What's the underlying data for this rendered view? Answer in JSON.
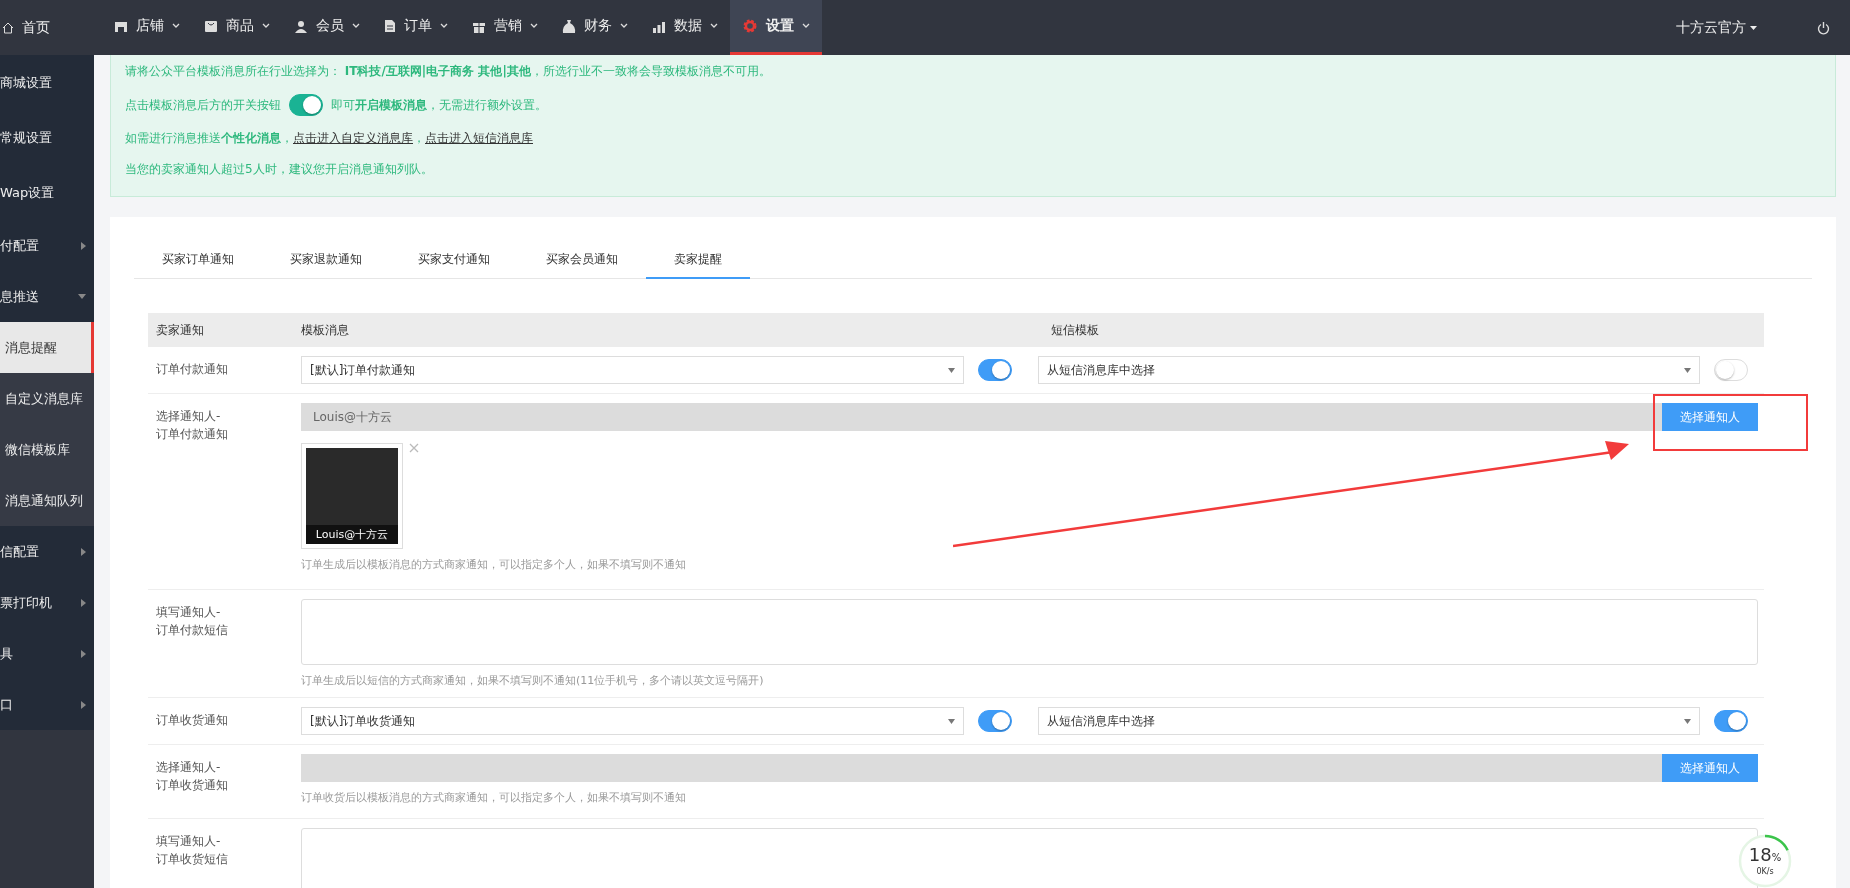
{
  "nav": {
    "home": "首页",
    "items": [
      {
        "label": "店铺",
        "selected": false
      },
      {
        "label": "商品",
        "selected": false
      },
      {
        "label": "会员",
        "selected": false
      },
      {
        "label": "订单",
        "selected": false
      },
      {
        "label": "营销",
        "selected": false
      },
      {
        "label": "财务",
        "selected": false
      },
      {
        "label": "数据",
        "selected": false
      },
      {
        "label": "设置",
        "selected": true
      }
    ],
    "user": "十方云官方"
  },
  "sidebar": {
    "items": [
      {
        "label": "商城设置",
        "kind": "plain",
        "selected": false
      },
      {
        "label": "常规设置",
        "kind": "plain",
        "selected": false
      },
      {
        "label": "Wap设置",
        "kind": "plain",
        "selected": false
      },
      {
        "label": "付配置",
        "kind": "group",
        "expanded": false
      },
      {
        "label": "息推送",
        "kind": "group",
        "expanded": true
      },
      {
        "label": "消息提醒",
        "kind": "sub",
        "selected": true
      },
      {
        "label": "自定义消息库",
        "kind": "sub",
        "selected": false
      },
      {
        "label": "微信模板库",
        "kind": "sub",
        "selected": false
      },
      {
        "label": "消息通知队列",
        "kind": "sub",
        "selected": false
      },
      {
        "label": "信配置",
        "kind": "group",
        "expanded": false
      },
      {
        "label": "票打印机",
        "kind": "group",
        "expanded": false
      },
      {
        "label": "具",
        "kind": "group",
        "expanded": false
      },
      {
        "label": "口",
        "kind": "group",
        "expanded": false
      }
    ]
  },
  "notice": {
    "industry": "请将公众平台模板消息所在行业选择为： **IT科技/互联网|电子商务 其他|其他**，所选行业不一致将会导致模板消息不可用。",
    "toggle_before": "点击模板消息后方的开关按钮",
    "toggle_on": true,
    "toggle_after": "即可**开启模板消息**，无需进行额外设置。",
    "custom_before": "如需进行消息推送**个性化消息**，",
    "links": [
      "点击进入自定义消息库",
      "点击进入短信消息库"
    ],
    "link_separator": "，",
    "queue": "当您的卖家通知人超过5人时，建议您开启消息通知列队。"
  },
  "tabs": [
    {
      "label": "买家订单通知",
      "selected": false
    },
    {
      "label": "买家退款通知",
      "selected": false
    },
    {
      "label": "买家支付通知",
      "selected": false
    },
    {
      "label": "买家会员通知",
      "selected": false
    },
    {
      "label": "卖家提醒",
      "selected": true
    }
  ],
  "table": {
    "columns": [
      "卖家通知",
      "模板消息",
      "短信模板"
    ],
    "rows": [
      {
        "kind": "notify",
        "label": [
          "订单付款通知"
        ],
        "template": "[默认]订单付款通知",
        "template_on": true,
        "sms": "从短信消息库中选择",
        "sms_on": false
      },
      {
        "kind": "notifier",
        "label": [
          "选择通知人-",
          "订单付款通知"
        ],
        "value": "Louis@十方云",
        "button": "选择通知人",
        "contacts": [
          {
            "name": "Louis@十方云"
          }
        ],
        "hint": "订单生成后以模板消息的方式商家通知，可以指定多个人，如果不填写则不通知"
      },
      {
        "kind": "phone",
        "label": [
          "填写通知人-",
          "订单付款短信"
        ],
        "hint": "订单生成后以短信的方式商家通知，如果不填写则不通知(11位手机号，多个请以英文逗号隔开)"
      },
      {
        "kind": "notify",
        "label": [
          "订单收货通知"
        ],
        "template": "[默认]订单收货通知",
        "template_on": true,
        "sms": "从短信消息库中选择",
        "sms_on": true
      },
      {
        "kind": "notifier",
        "label": [
          "选择通知人-",
          "订单收货通知"
        ],
        "value": "",
        "button": "选择通知人",
        "contacts": [],
        "hint": "订单收货后以模板消息的方式商家通知，可以指定多个人，如果不填写则不通知"
      },
      {
        "kind": "phone",
        "label": [
          "填写通知人-",
          "订单收货短信"
        ]
      }
    ]
  },
  "widget": {
    "percent": "18",
    "unit": "%",
    "speed": "0K/s"
  }
}
